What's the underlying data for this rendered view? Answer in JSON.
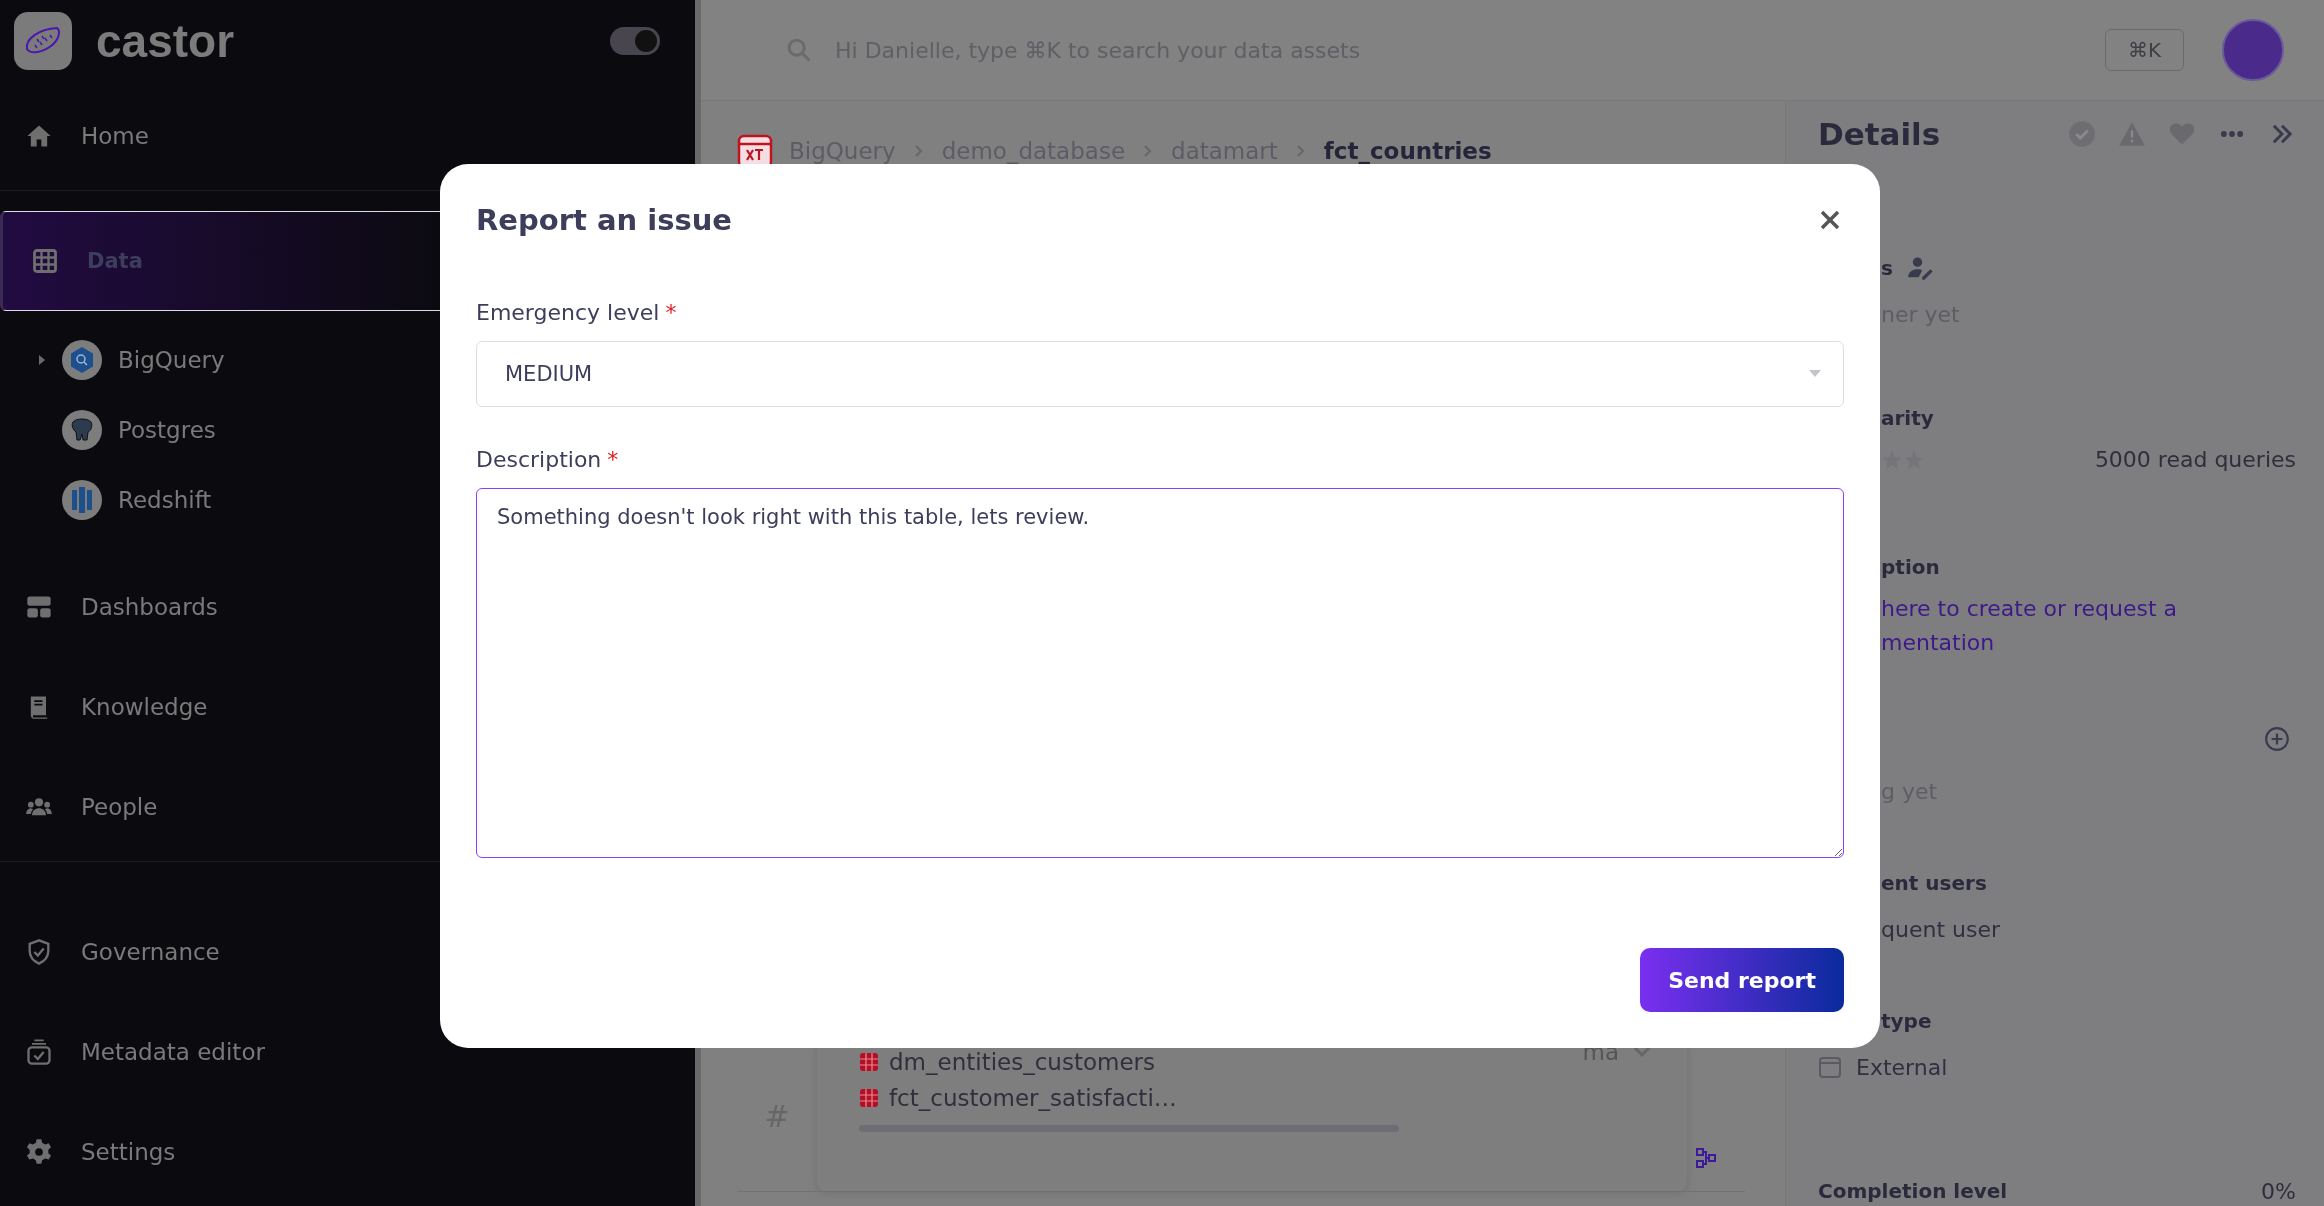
{
  "sidebar": {
    "logo": "castor",
    "theme_toggle": {
      "on": true
    },
    "sections": [
      [
        {
          "label": "Home",
          "kind": "home",
          "selected": false
        }
      ],
      [
        {
          "label": "Data",
          "kind": "grid",
          "selected": true,
          "children": [
            {
              "label": "BigQuery",
              "kind": "bigquery",
              "collapsible": true
            },
            {
              "label": "Postgres",
              "kind": "postgres",
              "collapsible": false
            },
            {
              "label": "Redshift",
              "kind": "redshift",
              "collapsible": false
            }
          ]
        },
        {
          "label": "Dashboards",
          "kind": "dashboards",
          "selected": false
        },
        {
          "label": "Knowledge",
          "kind": "book",
          "selected": false
        },
        {
          "label": "People",
          "kind": "people",
          "selected": false
        }
      ],
      [
        {
          "label": "Governance",
          "kind": "shield",
          "selected": false
        },
        {
          "label": "Metadata editor",
          "kind": "editor",
          "selected": false
        },
        {
          "label": "Settings",
          "kind": "gear",
          "selected": false
        }
      ]
    ]
  },
  "search": {
    "placeholder": "Hi Danielle, type ⌘K to search your data assets",
    "shortcut": "⌘K"
  },
  "breadcrumb": [
    "BigQuery",
    "demo_database",
    "datamart",
    "fct_countries"
  ],
  "lineage": {
    "row_marker": "#",
    "column_label": "ma",
    "tables": [
      "dm_entities_customers",
      "fct_customer_satisfacti…"
    ]
  },
  "details": {
    "title": "Details",
    "sections": [
      {
        "kind": "owners",
        "heading": "s",
        "value": "ner yet"
      },
      {
        "kind": "popularity",
        "heading": "arity",
        "reading": "5000 read queries"
      },
      {
        "kind": "description",
        "heading": "ption",
        "lines": [
          "here to create or request a",
          "mentation"
        ]
      },
      {
        "kind": "tags",
        "value": "g yet"
      },
      {
        "kind": "users",
        "heading": "ent users",
        "value": "quent user"
      },
      {
        "kind": "type",
        "heading": "type",
        "value": "External"
      },
      {
        "kind": "completion",
        "heading": "Completion level",
        "reading": "0%"
      }
    ]
  },
  "modal": {
    "title": "Report an issue",
    "fields": [
      {
        "kind": "select",
        "label": "Emergency level",
        "required_mark": "*",
        "value": "MEDIUM"
      },
      {
        "kind": "textarea",
        "label": "Description",
        "required_mark": "*",
        "value": "Something doesn't look right with this table, lets review."
      }
    ],
    "submit": "Send report"
  }
}
